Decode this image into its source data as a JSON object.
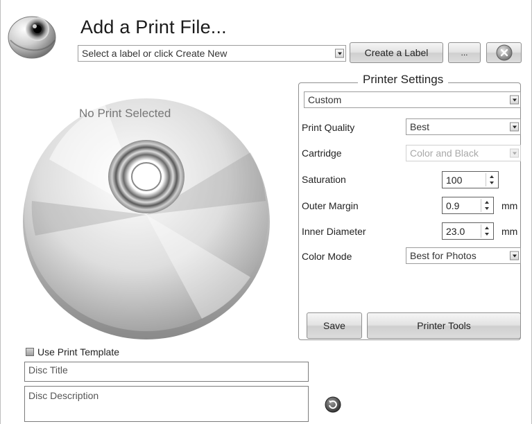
{
  "window": {
    "title": "Add a Print File..."
  },
  "header": {
    "label_select": {
      "value": "Select a label or click Create New"
    },
    "create_label_button": "Create a Label",
    "browse_button": "...",
    "close_button_icon": "close-x-icon",
    "app_icon": "disc-icon"
  },
  "preview": {
    "status_text": "No Print Selected",
    "image": "disc-graphic"
  },
  "printer_settings": {
    "title": "Printer Settings",
    "profile": "Custom",
    "print_quality": {
      "label": "Print Quality",
      "value": "Best"
    },
    "cartridge": {
      "label": "Cartridge",
      "value": "Color and Black",
      "disabled": true
    },
    "saturation": {
      "label": "Saturation",
      "value": "100"
    },
    "outer_margin": {
      "label": "Outer Margin",
      "value": "0.9",
      "unit": "mm"
    },
    "inner_diameter": {
      "label": "Inner Diameter",
      "value": "23.0",
      "unit": "mm"
    },
    "color_mode": {
      "label": "Color Mode",
      "value": "Best for Photos"
    },
    "save_button": "Save",
    "printer_tools_button": "Printer Tools"
  },
  "template": {
    "use_print_template": {
      "label": "Use Print Template",
      "checked": false
    },
    "disc_title": {
      "placeholder": "Disc Title"
    },
    "disc_description": {
      "placeholder": "Disc Description"
    },
    "refresh_icon": "refresh-icon"
  },
  "colors": {
    "background": "#ffffff",
    "border": "#8f8f8f",
    "button_gradient_top": "#f6f6f6",
    "button_gradient_bottom": "#cfcfcf",
    "disabled_text": "#a8a8a8"
  }
}
